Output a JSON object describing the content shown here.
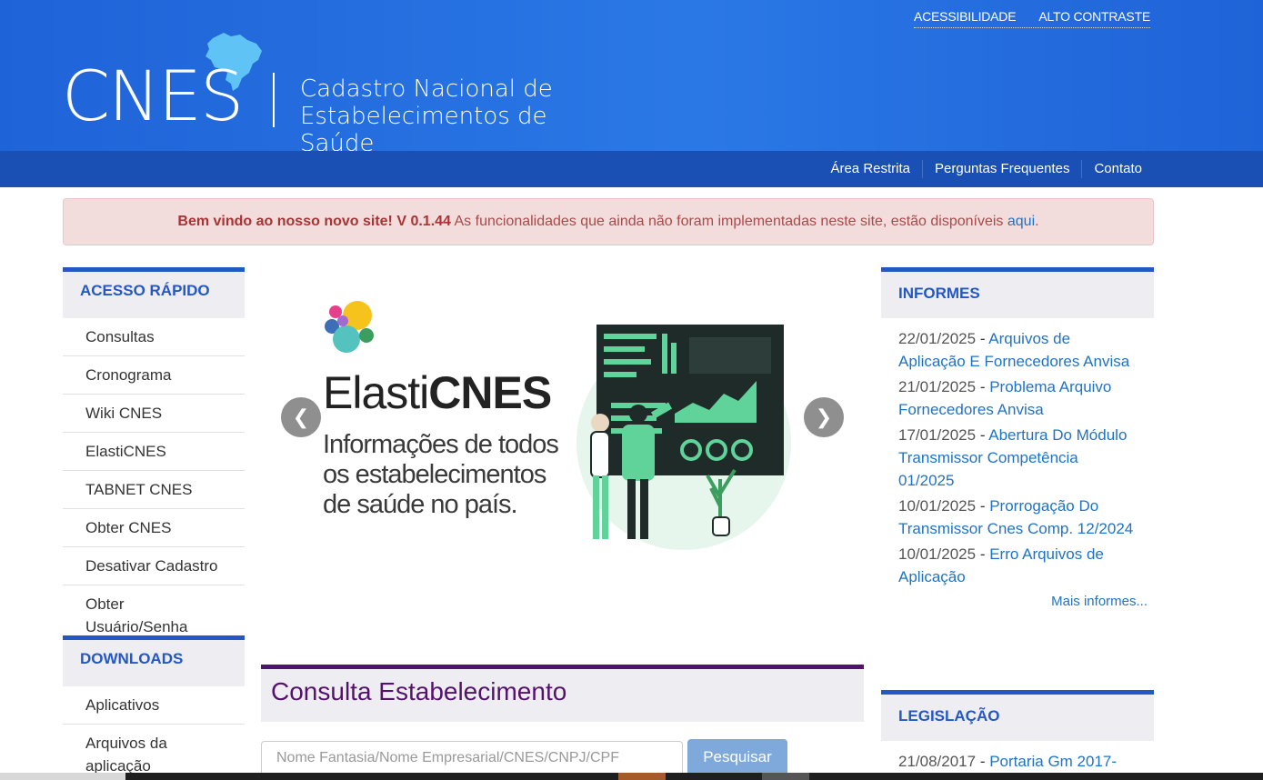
{
  "header": {
    "util_links": [
      "ACESSIBILIDADE",
      "ALTO CONTRASTE"
    ],
    "logo_acronym": "CNES",
    "logo_line1": "Cadastro Nacional de",
    "logo_line2": "Estabelecimentos de Saúde"
  },
  "navbar": {
    "items": [
      "Área Restrita",
      "Perguntas Frequentes",
      "Contato"
    ]
  },
  "alert": {
    "bold": "Bem vindo ao nosso novo site! V 0.1.44",
    "text": " As funcionalidades que ainda não foram implementadas neste site, estão disponíveis ",
    "link": "aqui",
    "end": "."
  },
  "acesso_rapido": {
    "title": "ACESSO RÁPIDO",
    "items": [
      "Consultas",
      "Cronograma",
      "Wiki CNES",
      "ElastiCNES",
      "TABNET CNES",
      "Obter CNES",
      "Desativar Cadastro",
      "Obter Usuário/Senha"
    ]
  },
  "downloads": {
    "title": "DOWNLOADS",
    "items": [
      "Aplicativos",
      "Arquivos da aplicação"
    ]
  },
  "carousel": {
    "brand_light": "Elasti",
    "brand_bold": "CNES",
    "tagline": [
      "Informações de todos",
      "os estabelecimentos",
      "de saúde no país."
    ],
    "prev": "❮",
    "next": "❯"
  },
  "consulta": {
    "title": "Consulta Estabelecimento",
    "placeholder": "Nome Fantasia/Nome Empresarial/CNES/CNPJ/CPF",
    "button": "Pesquisar"
  },
  "informes": {
    "title": "INFORMES",
    "items": [
      {
        "date": "22/01/2025",
        "title": "Arquivos de Aplicação E Fornecedores Anvisa"
      },
      {
        "date": "21/01/2025",
        "title": "Problema Arquivo Fornecedores Anvisa"
      },
      {
        "date": "17/01/2025",
        "title": "Abertura Do Módulo Transmissor Competência 01/2025"
      },
      {
        "date": "10/01/2025",
        "title": "Prorrogação Do Transmissor Cnes Comp. 12/2024"
      },
      {
        "date": "10/01/2025",
        "title": "Erro Arquivos de Aplicação"
      }
    ],
    "more": "Mais informes..."
  },
  "legislacao": {
    "title": "LEGISLAÇÃO",
    "items": [
      {
        "date": "21/08/2017",
        "title": "Portaria Gm 2017-"
      }
    ]
  }
}
